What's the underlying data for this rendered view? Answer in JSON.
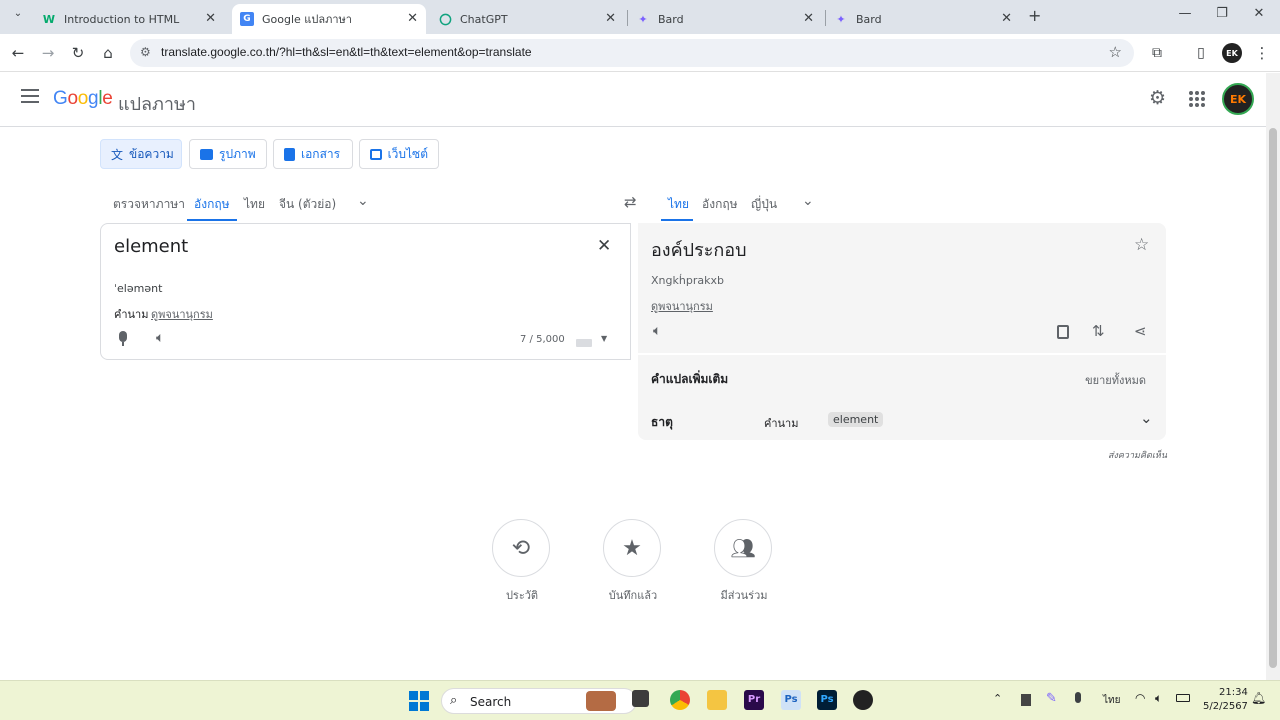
{
  "browser": {
    "tabs": [
      {
        "title": "Introduction to HTML",
        "favicon": "W"
      },
      {
        "title": "Google แปลภาษา",
        "favicon": "G"
      },
      {
        "title": "ChatGPT",
        "favicon": "chatgpt-icon"
      },
      {
        "title": "Bard",
        "favicon": "bard-icon"
      },
      {
        "title": "Bard",
        "favicon": "bard-icon"
      }
    ],
    "url": "translate.google.co.th/?hl=th&sl=en&tl=th&text=element&op=translate",
    "profile_initials": "EK"
  },
  "app": {
    "logo": "Google",
    "product": "แปลภาษา",
    "modes": [
      "ข้อความ",
      "รูปภาพ",
      "เอกสาร",
      "เว็บไซต์"
    ],
    "source_langs": [
      "ตรวจหาภาษา",
      "อังกฤษ",
      "ไทย",
      "จีน (ตัวย่อ)"
    ],
    "target_langs": [
      "ไทย",
      "อังกฤษ",
      "ญี่ปุ่น"
    ]
  },
  "source": {
    "text": "element",
    "phonetic": "ˈeləmənt",
    "pos": "คำนาม",
    "dict_link": "ดูพจนานุกรม",
    "char_count": "7 / 5,000"
  },
  "target": {
    "text": "องค์ประกอบ",
    "romanization": "Xngkh̒prakxb",
    "dict_link": "ดูพจนานุกรม"
  },
  "more": {
    "title": "คำแปลเพิ่มเติม",
    "expand": "ขยายทั้งหมด",
    "row_word": "ธาตุ",
    "row_pos": "คำนาม",
    "row_chip": "element"
  },
  "feedback": "ส่งความคิดเห็น",
  "bottom_actions": [
    "ประวัติ",
    "บันทึกแล้ว",
    "มีส่วนร่วม"
  ],
  "taskbar": {
    "search": "Search",
    "lang": "ไทย",
    "time": "21:34",
    "date": "5/2/2567"
  },
  "colors": {
    "accent": "#1a73e8",
    "taskbar": "#eef4d4"
  }
}
